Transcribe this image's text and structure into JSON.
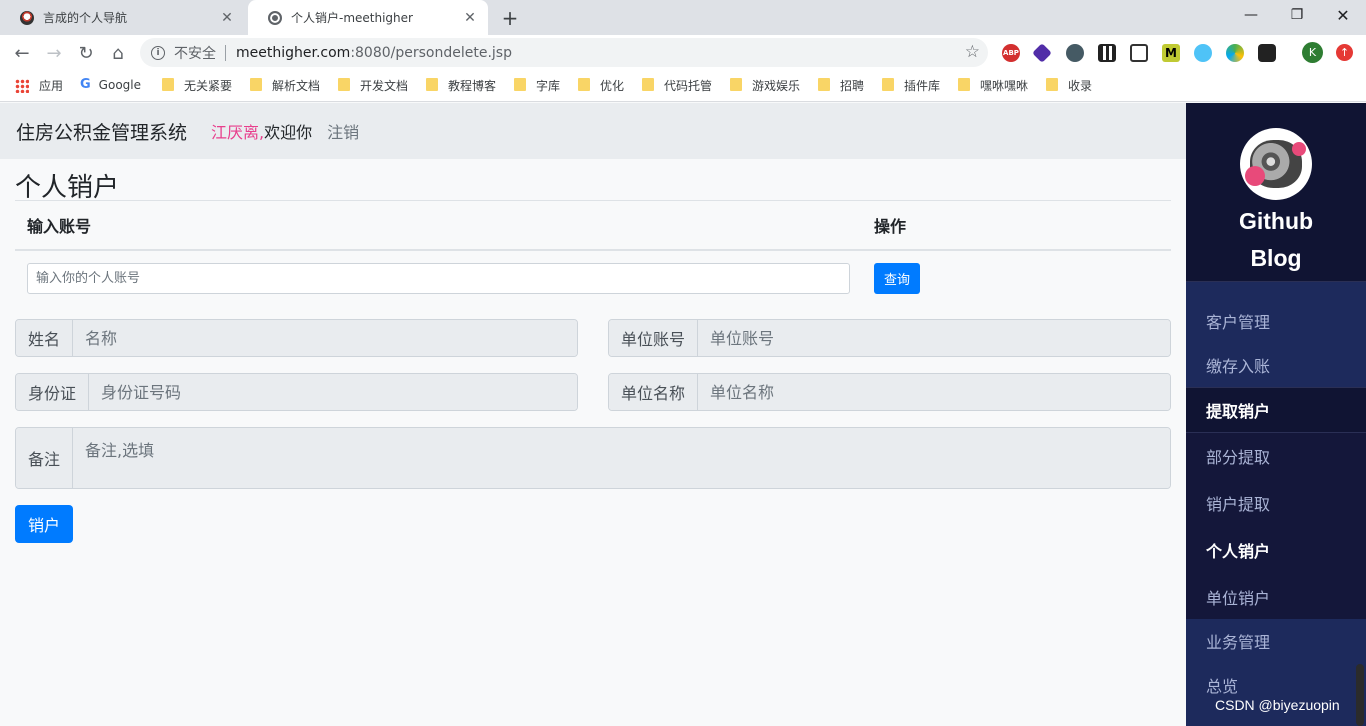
{
  "browser": {
    "tabs": [
      {
        "title": "言成的个人导航"
      },
      {
        "title": "个人销户-meethigher"
      }
    ],
    "window_controls": {
      "minimize": "—",
      "maximize": "❐",
      "close": "✕"
    },
    "address": {
      "security_label": "不安全",
      "host": "meethigher.com",
      "rest": ":8080/persondelete.jsp"
    },
    "profile_initial": "K",
    "extensions": {
      "abp": "ABP",
      "m": "M"
    },
    "bookmarks": [
      "应用",
      "Google",
      "无关紧要",
      "解析文档",
      "开发文档",
      "教程博客",
      "字库",
      "优化",
      "代码托管",
      "游戏娱乐",
      "招聘",
      "插件库",
      "嘿咻嘿咻",
      "收录"
    ]
  },
  "navbar": {
    "brand": "住房公积金管理系统",
    "user_name": "江厌离,",
    "welcome": "欢迎你",
    "logout": "注销"
  },
  "page": {
    "title": "个人销户",
    "table_headers": {
      "account": "输入账号",
      "action": "操作"
    },
    "account_placeholder": "输入你的个人账号",
    "query_label": "查询",
    "fields": {
      "name": {
        "label": "姓名",
        "placeholder": "名称"
      },
      "unit_account": {
        "label": "单位账号",
        "placeholder": "单位账号"
      },
      "idcard": {
        "label": "身份证",
        "placeholder": "身份证号码"
      },
      "unit_name": {
        "label": "单位名称",
        "placeholder": "单位名称"
      },
      "remark": {
        "label": "备注",
        "placeholder": "备注,选填"
      }
    },
    "submit_label": "销户"
  },
  "sidebar": {
    "brand_line1": "Github",
    "brand_line2": "Blog",
    "items": [
      {
        "label": "客户管理"
      },
      {
        "label": "缴存入账"
      },
      {
        "label": "提取销户"
      },
      {
        "label": "部分提取"
      },
      {
        "label": "销户提取"
      },
      {
        "label": "个人销户"
      },
      {
        "label": "单位销户"
      },
      {
        "label": "业务管理"
      },
      {
        "label": "总览"
      }
    ]
  },
  "watermark": "CSDN @biyezuopin"
}
